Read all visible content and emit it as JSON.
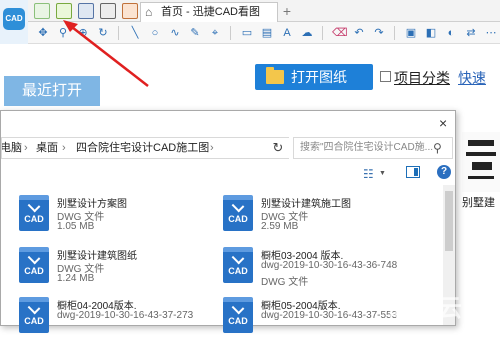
{
  "app": {
    "logo_text": "CAD"
  },
  "tabs": {
    "home_label": "首页 - 迅捷CAD看图",
    "new_tab": "+"
  },
  "home": {
    "recent_label": "最近打开",
    "open_button": "打开图纸",
    "classify_label": "项目分类",
    "quick_label": "快速",
    "bg_thumb_caption": "别墅建"
  },
  "dialog": {
    "close": "×",
    "breadcrumb": [
      "电脑",
      "桌面",
      "四合院住宅设计CAD施工图"
    ],
    "search_placeholder": "搜索\"四合院住宅设计CAD施...",
    "help": "?"
  },
  "files": [
    {
      "name": "别墅设计方案图",
      "type": "DWG 文件",
      "size": "1.05 MB"
    },
    {
      "name": "别墅设计建筑施工图",
      "type": "DWG 文件",
      "size": "2.59 MB"
    },
    {
      "name": "别墅设计建筑图纸",
      "type": "DWG 文件",
      "size": "1.24 MB"
    },
    {
      "name": "橱柜03-2004 版本.",
      "type": "dwg-2019-10-30-16-43-36-748",
      "size": "DWG 文件"
    },
    {
      "name": "橱柜04-2004版本.",
      "type": "dwg-2019-10-30-16-43-37-273",
      "size": ""
    },
    {
      "name": "橱柜05-2004版本.",
      "type": "dwg-2019-10-30-16-43-37-553",
      "size": ""
    }
  ],
  "watermark": "亿速云",
  "colors": {
    "accent": "#1e80d8",
    "recent_bg": "#7fb6e4",
    "arrow": "#e02020",
    "cad_icon": "#2872c6"
  }
}
